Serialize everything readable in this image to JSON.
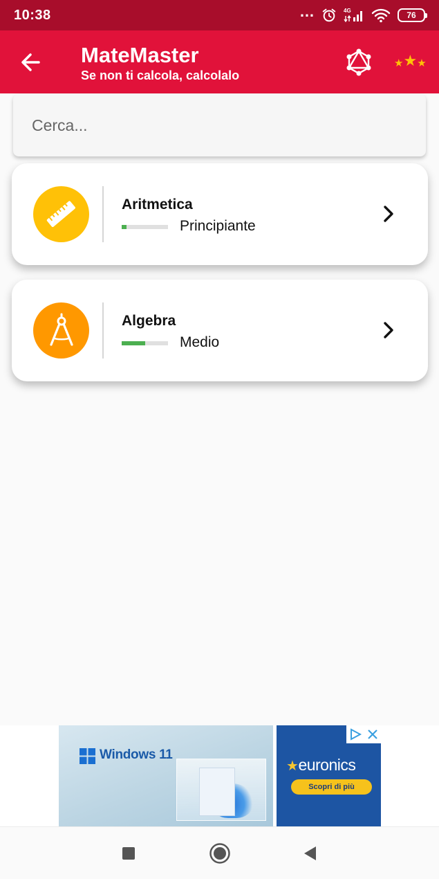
{
  "status_bar": {
    "time": "10:38",
    "network": "4G",
    "battery": "76"
  },
  "app_bar": {
    "title": "MateMaster",
    "subtitle": "Se non ti calcola, calcolalo",
    "back_icon": "arrow-back-icon",
    "graph_icon": "graph-network-icon",
    "stars_icon": "stars-icon",
    "background_color": "#e1123a"
  },
  "search": {
    "placeholder": "Cerca...",
    "value": ""
  },
  "topics": [
    {
      "title": "Aritmetica",
      "level": "Principiante",
      "progress": 0.1,
      "icon": "ruler-icon",
      "icon_color": "#ffc107"
    },
    {
      "title": "Algebra",
      "level": "Medio",
      "progress": 0.5,
      "icon": "compass-icon",
      "icon_color": "#ff9800"
    }
  ],
  "ad": {
    "left_brand": "Windows 11",
    "right_brand": "euronics",
    "cta": "Scopri di più"
  },
  "nav": {
    "recents_icon": "square-icon",
    "home_icon": "circle-icon",
    "back_icon": "triangle-back-icon"
  }
}
